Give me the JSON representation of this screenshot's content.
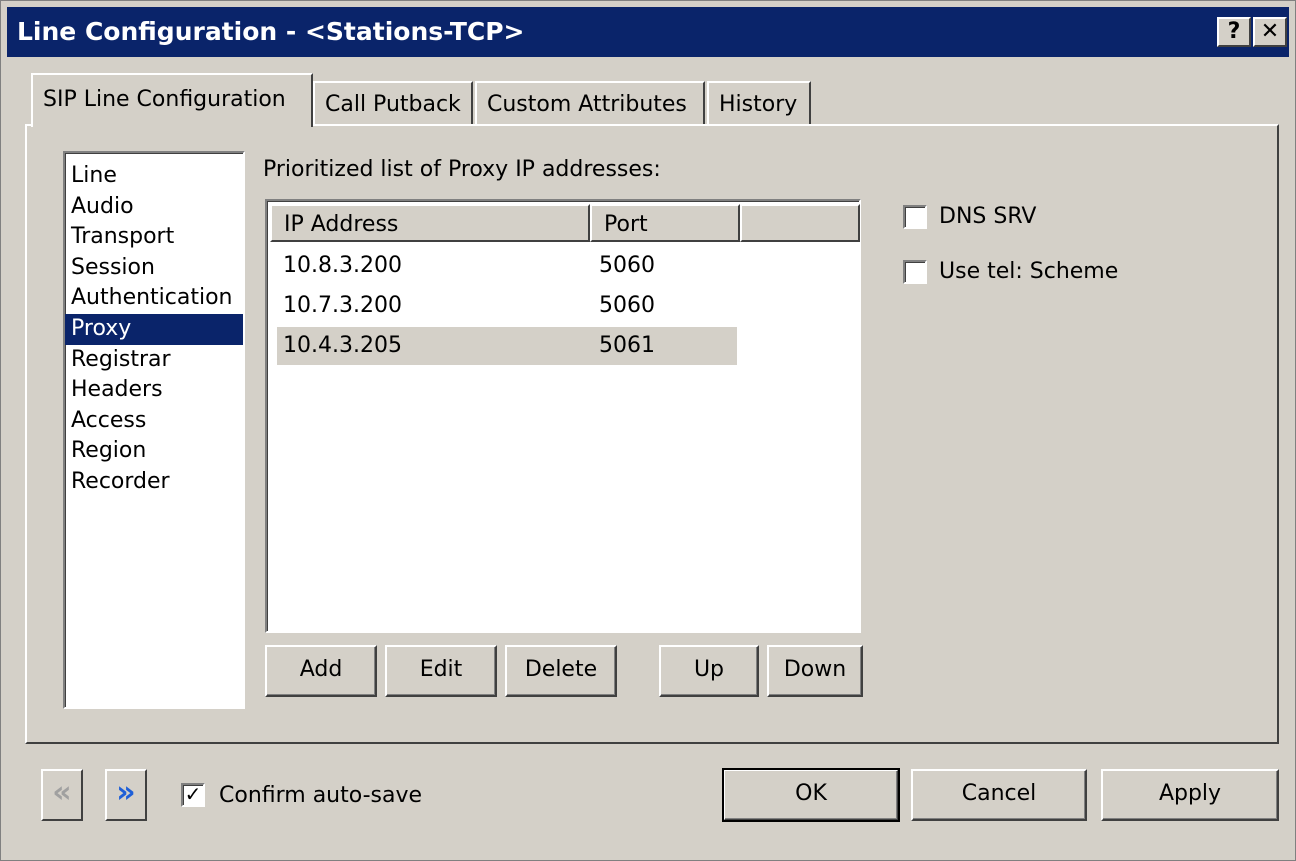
{
  "window": {
    "title": "Line Configuration - <Stations-TCP>",
    "help_glyph": "?",
    "close_glyph": "✕"
  },
  "tabs": [
    {
      "label": "SIP Line Configuration",
      "active": true
    },
    {
      "label": "Call Putback",
      "active": false
    },
    {
      "label": "Custom Attributes",
      "active": false
    },
    {
      "label": "History",
      "active": false
    }
  ],
  "nav_items": [
    {
      "label": "Line"
    },
    {
      "label": "Audio"
    },
    {
      "label": "Transport"
    },
    {
      "label": "Session"
    },
    {
      "label": "Authentication"
    },
    {
      "label": "Proxy",
      "selected": true
    },
    {
      "label": "Registrar"
    },
    {
      "label": "Headers"
    },
    {
      "label": "Access"
    },
    {
      "label": "Region"
    },
    {
      "label": "Recorder"
    }
  ],
  "proxy": {
    "label": "Prioritized list of Proxy IP addresses:",
    "columns": [
      "IP Address",
      "Port"
    ],
    "rows": [
      {
        "ip": "10.8.3.200",
        "port": "5060"
      },
      {
        "ip": "10.7.3.200",
        "port": "5060"
      },
      {
        "ip": "10.4.3.205",
        "port": "5061",
        "selected": true
      }
    ],
    "buttons": {
      "add": "Add",
      "edit": "Edit",
      "delete": "Delete",
      "up": "Up",
      "down": "Down"
    }
  },
  "options": {
    "dns_srv": {
      "label": "DNS SRV",
      "checked": false
    },
    "use_tel_scheme": {
      "label": "Use tel: Scheme",
      "checked": false
    }
  },
  "footer": {
    "prev_glyph": "«",
    "next_glyph": "»",
    "confirm_autosave": {
      "label": "Confirm auto-save",
      "checked": true,
      "mark": "✓"
    },
    "ok": "OK",
    "cancel": "Cancel",
    "apply": "Apply"
  },
  "colors": {
    "title_bg": "#0a246a",
    "face": "#d4d0c8",
    "selection": "#0a246a",
    "next_arrow": "#1e5fd8",
    "prev_arrow_disabled": "#a0a0a0"
  }
}
